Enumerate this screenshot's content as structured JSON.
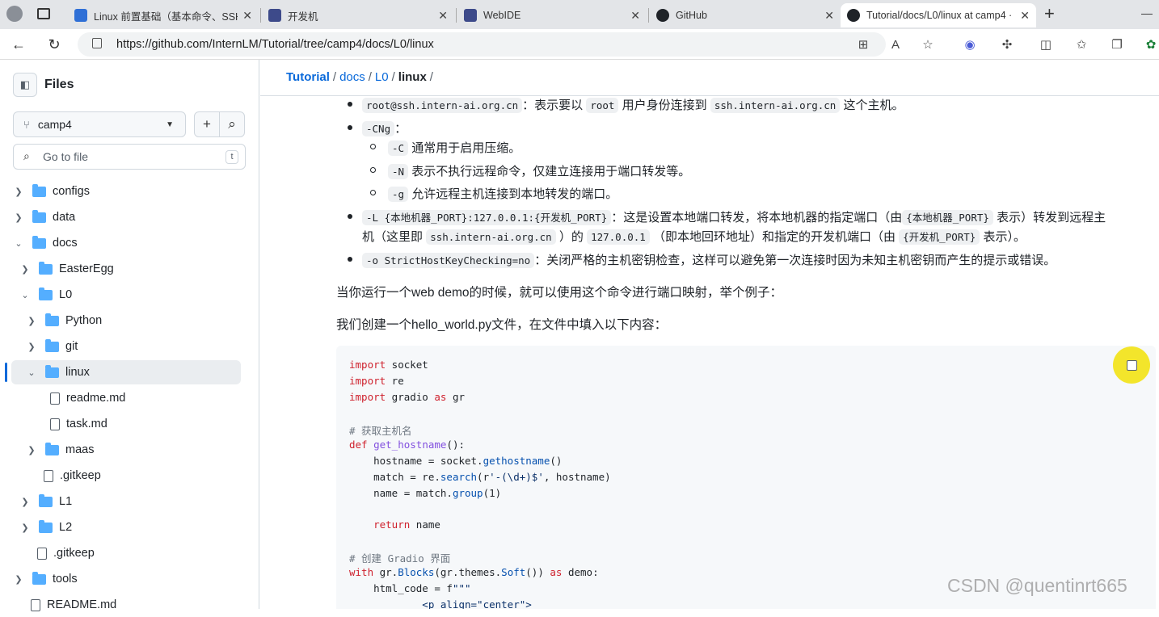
{
  "browser": {
    "tabs": [
      {
        "title": "Linux 前置基础（基本命令、SSH",
        "icon": "gitbook-tab-icon"
      },
      {
        "title": "开发机",
        "icon": "intern-tab-icon"
      },
      {
        "title": "WebIDE",
        "icon": "intern-tab-icon"
      },
      {
        "title": "GitHub",
        "icon": "github-icon"
      },
      {
        "title": "Tutorial/docs/L0/linux at camp4 ·",
        "icon": "github-icon"
      }
    ],
    "url": "https://github.com/InternLM/Tutorial/tree/camp4/docs/L0/linux"
  },
  "sidebar": {
    "title": "Files",
    "branch": "camp4",
    "goto_placeholder": "Go to file",
    "goto_key": "t",
    "tree": [
      {
        "label": "configs",
        "type": "folder"
      },
      {
        "label": "data",
        "type": "folder"
      },
      {
        "label": "docs",
        "type": "folder"
      },
      {
        "label": "EasterEgg",
        "type": "folder"
      },
      {
        "label": "L0",
        "type": "folder"
      },
      {
        "label": "Python",
        "type": "folder"
      },
      {
        "label": "git",
        "type": "folder"
      },
      {
        "label": "linux",
        "type": "folder"
      },
      {
        "label": "readme.md",
        "type": "file"
      },
      {
        "label": "task.md",
        "type": "file"
      },
      {
        "label": "maas",
        "type": "folder"
      },
      {
        "label": ".gitkeep",
        "type": "file"
      },
      {
        "label": "L1",
        "type": "folder"
      },
      {
        "label": "L2",
        "type": "folder"
      },
      {
        "label": ".gitkeep",
        "type": "file"
      },
      {
        "label": "tools",
        "type": "folder"
      },
      {
        "label": "README.md",
        "type": "file"
      }
    ]
  },
  "breadcrumb": {
    "b1": "Tutorial",
    "b2": "docs",
    "b3": "L0",
    "b4": "linux",
    "sep": "/"
  },
  "content": {
    "l1_code1": "root@ssh.intern-ai.org.cn",
    "l1_t1": "：表示要以",
    "l1_code2": "root",
    "l1_t2": "用户身份连接到",
    "l1_code3": "ssh.intern-ai.org.cn",
    "l1_t3": "这个主机。",
    "l2_code": "-CNg",
    "l2_t": "：",
    "s1_code": "-C",
    "s1_t": "通常用于启用压缩。",
    "s2_code": "-N",
    "s2_t": "表示不执行远程命令，仅建立连接用于端口转发等。",
    "s3_code": "-g",
    "s3_t": "允许远程主机连接到本地转发的端口。",
    "l3_code1": "-L {本地机器_PORT}:127.0.0.1:{开发机_PORT}",
    "l3_t1": "：这是设置本地端口转发，将本地机器的指定端口（由",
    "l3_code2": "{本地机器_PORT}",
    "l3_t2": "表示）转发到远程主",
    "l3_t3": "机（这里即",
    "l3_code3": "ssh.intern-ai.org.cn",
    "l3_t4": "）的",
    "l3_code4": "127.0.0.1",
    "l3_t5": "（即本地回环地址）和指定的开发机端口（由",
    "l3_code5": "{开发机_PORT}",
    "l3_t6": "表示）。",
    "l4_code": "-o StrictHostKeyChecking=no",
    "l4_t": "：关闭严格的主机密钥检查，这样可以避免第一次连接时因为未知主机密钥而产生的提示或错误。",
    "p1": "当你运行一个web demo的时候，就可以使用这个命令进行端口映射，举个例子：",
    "p2": "我们创建一个hello_world.py文件，在文件中填入以下内容："
  },
  "code": [
    "import socket",
    "import re",
    "import gradio as gr",
    "",
    "# 获取主机名",
    "def get_hostname():",
    "    hostname = socket.gethostname()",
    "    match = re.search(r'-(\\d+)$', hostname)",
    "    name = match.group(1)",
    "",
    "    return name",
    "",
    "# 创建 Gradio 界面",
    "with gr.Blocks(gr.themes.Soft()) as demo:",
    "    html_code = f\"\"\"",
    "            <p align=\"center\">"
  ],
  "watermark": "CSDN @quentinrt665",
  "colors": {
    "link": "#0969da",
    "folder": "#54aeff",
    "highlight": "#f3e52b"
  }
}
